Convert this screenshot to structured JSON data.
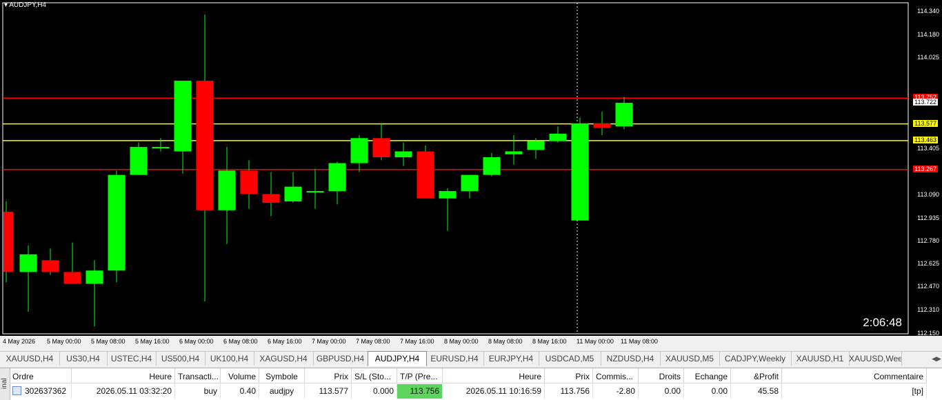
{
  "chart": {
    "symbol_label": "AUDJPY,H4",
    "timer": "2:06:48",
    "y_ticks": [
      "114.340",
      "114.180",
      "114.025",
      "113.405",
      "113.090",
      "112.935",
      "112.780",
      "112.625",
      "112.470",
      "112.310",
      "112.150"
    ],
    "price_labels": [
      {
        "value": "113.752",
        "color": "#ff0000",
        "text_color": "#ffffff",
        "line": "#ff0000",
        "price": 113.752
      },
      {
        "value": "113.722",
        "color": "#ffffff",
        "text_color": "#000000",
        "line": null,
        "price": 113.722
      },
      {
        "value": "113.577",
        "color": "#ffff00",
        "text_color": "#000000",
        "line": "#ffff00",
        "price": 113.577
      },
      {
        "value": "113.463",
        "color": "#ffff00",
        "text_color": "#000000",
        "line": "#ffff00",
        "price": 113.463
      },
      {
        "value": "113.267",
        "color": "#ff0000",
        "text_color": "#ffffff",
        "line": "#ff0000",
        "price": 113.267
      }
    ],
    "x_ticks": [
      "4 May 2026",
      "5 May 00:00",
      "5 May 08:00",
      "5 May 16:00",
      "6 May 00:00",
      "6 May 08:00",
      "6 May 16:00",
      "7 May 00:00",
      "7 May 08:00",
      "7 May 16:00",
      "8 May 00:00",
      "8 May 08:00",
      "8 May 16:00",
      "11 May 00:00",
      "11 May 08:00"
    ],
    "colors": {
      "bull": "#00ff00",
      "bear": "#ff0000",
      "wick": "#00ff00",
      "grid": "#000000"
    }
  },
  "chart_data": {
    "type": "candlestick",
    "title": "AUDJPY,H4",
    "ylim": [
      112.15,
      114.4
    ],
    "candles": [
      {
        "o": 112.98,
        "h": 113.05,
        "l": 112.5,
        "c": 112.57
      },
      {
        "o": 112.57,
        "h": 112.75,
        "l": 112.3,
        "c": 112.69
      },
      {
        "o": 112.65,
        "h": 112.73,
        "l": 112.55,
        "c": 112.57
      },
      {
        "o": 112.57,
        "h": 112.77,
        "l": 112.5,
        "c": 112.49
      },
      {
        "o": 112.49,
        "h": 112.65,
        "l": 112.2,
        "c": 112.58
      },
      {
        "o": 112.58,
        "h": 113.26,
        "l": 112.5,
        "c": 113.23
      },
      {
        "o": 113.23,
        "h": 113.45,
        "l": 113.23,
        "c": 113.42
      },
      {
        "o": 113.42,
        "h": 113.48,
        "l": 113.39,
        "c": 113.42
      },
      {
        "o": 113.39,
        "h": 113.87,
        "l": 113.24,
        "c": 113.87
      },
      {
        "o": 113.87,
        "h": 114.32,
        "l": 112.37,
        "c": 112.99
      },
      {
        "o": 112.99,
        "h": 113.42,
        "l": 112.76,
        "c": 113.26
      },
      {
        "o": 113.26,
        "h": 113.33,
        "l": 113.0,
        "c": 113.1
      },
      {
        "o": 113.1,
        "h": 113.25,
        "l": 112.95,
        "c": 113.04
      },
      {
        "o": 113.05,
        "h": 113.25,
        "l": 113.04,
        "c": 113.15
      },
      {
        "o": 113.12,
        "h": 113.27,
        "l": 113.0,
        "c": 113.12
      },
      {
        "o": 113.12,
        "h": 113.32,
        "l": 113.03,
        "c": 113.31
      },
      {
        "o": 113.31,
        "h": 113.5,
        "l": 113.25,
        "c": 113.48
      },
      {
        "o": 113.48,
        "h": 113.58,
        "l": 113.33,
        "c": 113.35
      },
      {
        "o": 113.35,
        "h": 113.45,
        "l": 113.29,
        "c": 113.39
      },
      {
        "o": 113.39,
        "h": 113.43,
        "l": 113.08,
        "c": 113.07
      },
      {
        "o": 113.07,
        "h": 113.14,
        "l": 112.85,
        "c": 113.12
      },
      {
        "o": 113.12,
        "h": 113.2,
        "l": 113.07,
        "c": 113.23
      },
      {
        "o": 113.23,
        "h": 113.38,
        "l": 113.22,
        "c": 113.35
      },
      {
        "o": 113.37,
        "h": 113.5,
        "l": 113.3,
        "c": 113.39
      },
      {
        "o": 113.4,
        "h": 113.48,
        "l": 113.34,
        "c": 113.46
      },
      {
        "o": 113.46,
        "h": 113.56,
        "l": 113.45,
        "c": 113.51
      },
      {
        "o": 112.92,
        "h": 113.62,
        "l": 112.92,
        "c": 113.58
      },
      {
        "o": 113.58,
        "h": 113.66,
        "l": 113.5,
        "c": 113.55
      },
      {
        "o": 113.56,
        "h": 113.76,
        "l": 113.54,
        "c": 113.72
      }
    ]
  },
  "tabs": [
    {
      "label": "XAUUSD,H4",
      "active": false
    },
    {
      "label": "US30,H4",
      "active": false
    },
    {
      "label": "USTEC,H4",
      "active": false
    },
    {
      "label": "US500,H4",
      "active": false
    },
    {
      "label": "UK100,H4",
      "active": false
    },
    {
      "label": "XAGUSD,H4",
      "active": false
    },
    {
      "label": "GBPUSD,H4",
      "active": false
    },
    {
      "label": "AUDJPY,H4",
      "active": true
    },
    {
      "label": "EURUSD,H4",
      "active": false
    },
    {
      "label": "EURJPY,H4",
      "active": false
    },
    {
      "label": "USDCAD,M5",
      "active": false
    },
    {
      "label": "NZDUSD,H4",
      "active": false
    },
    {
      "label": "XAUUSD,M5",
      "active": false
    },
    {
      "label": "CADJPY,Weekly",
      "active": false
    },
    {
      "label": "XAUUSD,H1",
      "active": false
    },
    {
      "label": "XAUUSD,Wee",
      "active": false
    }
  ],
  "terminal": {
    "side_label": "inal",
    "headers": [
      "Ordre",
      "Heure",
      "Transacti...",
      "Volume",
      "Symbole",
      "Prix",
      "S/L (Sto...",
      "T/P (Pre...",
      "Heure",
      "Prix",
      "Commis...",
      "Droits",
      "Echange",
      "&Profit",
      "Commentaire"
    ],
    "row": [
      "302637362",
      "2026.05.11 03:32:20",
      "buy",
      "0.40",
      "audjpy",
      "113.577",
      "0.000",
      "113.756",
      "2026.05.11 10:16:59",
      "113.756",
      "-2.80",
      "0.00",
      "0.00",
      "45.58",
      "[tp]"
    ],
    "tp_highlight": "#5ed45e"
  }
}
